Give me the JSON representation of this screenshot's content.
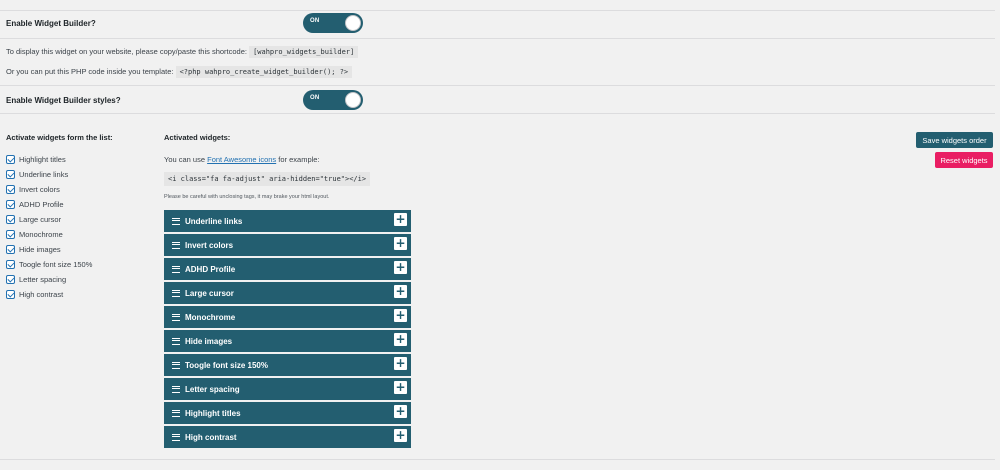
{
  "settings": {
    "enable_builder_label": "Enable Widget Builder?",
    "enable_builder_toggle": "ON",
    "shortcode_text": "To display this widget on your website, please copy/paste this shortcode:",
    "shortcode_code": "[wahpro_widgets_builder]",
    "php_text": "Or you can put this PHP code inside you template:",
    "php_code": "<?php wahpro_create_widget_builder(); ?>",
    "enable_styles_label": "Enable Widget Builder styles?",
    "enable_styles_toggle": "ON"
  },
  "activate_list": {
    "title": "Activate widgets form the list:",
    "items": [
      "Highlight titles",
      "Underline links",
      "Invert colors",
      "ADHD Profile",
      "Large cursor",
      "Monochrome",
      "Hide images",
      "Toogle font size 150%",
      "Letter spacing",
      "High contrast"
    ]
  },
  "activated": {
    "title": "Activated widgets:",
    "hint_prefix": "You can use",
    "hint_link": "Font Awesome icons",
    "hint_suffix": "for example:",
    "example_code": "<i class=\"fa fa-adjust\" aria-hidden=\"true\"></i>",
    "warning": "Please be careful with unclosing tags, it may brake your html layout.",
    "widgets": [
      "Underline links",
      "Invert colors",
      "ADHD Profile",
      "Large cursor",
      "Monochrome",
      "Hide images",
      "Toogle font size 150%",
      "Letter spacing",
      "Highlight titles",
      "High contrast"
    ],
    "plus_symbol": "+"
  },
  "buttons": {
    "save_label": "Save widgets order",
    "reset_label": "Reset widgets"
  },
  "colors": {
    "toggle_bg": "#235e70",
    "widget_bar": "#235e70",
    "save_button": "#235e70",
    "reset_button": "#e91e63",
    "link": "#2271b1"
  }
}
